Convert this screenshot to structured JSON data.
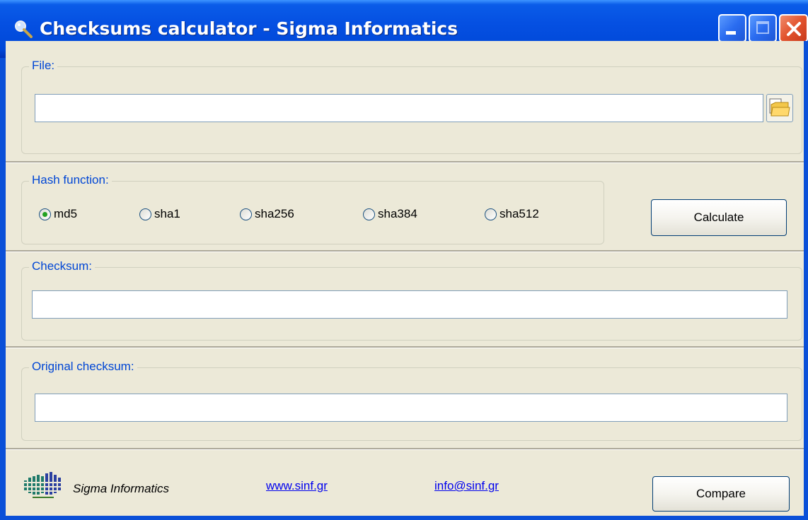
{
  "window": {
    "title": "Checksums calculator - Sigma Informatics",
    "icons": {
      "app": "magnifier-icon",
      "minimize": "minimize-icon",
      "maximize": "maximize-icon",
      "close": "close-icon"
    }
  },
  "file_group": {
    "legend": "File:",
    "path_value": "",
    "browse_icon": "folder-icon"
  },
  "hash_group": {
    "legend": "Hash function:",
    "options": [
      {
        "label": "md5",
        "checked": true
      },
      {
        "label": "sha1",
        "checked": false
      },
      {
        "label": "sha256",
        "checked": false
      },
      {
        "label": "sha384",
        "checked": false
      },
      {
        "label": "sha512",
        "checked": false
      }
    ],
    "calculate_label": "Calculate"
  },
  "checksum_group": {
    "legend": "Checksum:",
    "value": ""
  },
  "original_group": {
    "legend": "Original checksum:",
    "value": ""
  },
  "footer": {
    "company": "Sigma Informatics",
    "website": "www.sinf.gr",
    "email": "info@sinf.gr",
    "compare_label": "Compare",
    "logo_icon": "sigma-logo-icon"
  },
  "colors": {
    "titlebar": "#0550e2",
    "legend_text": "#0046d5",
    "link": "#0000ee",
    "dialog_bg": "#ece9d8"
  }
}
